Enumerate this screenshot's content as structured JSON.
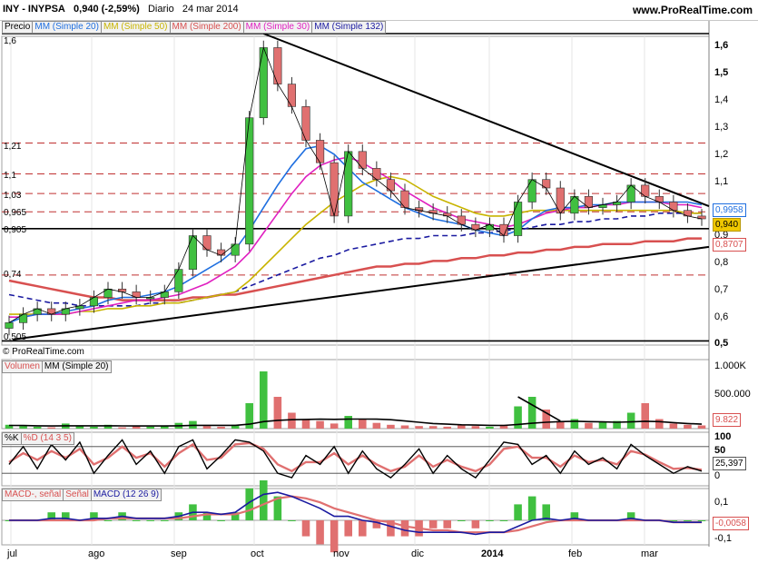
{
  "header": {
    "symbol": "INY - INYPSA",
    "quote": "0,940 (-2,59%)",
    "period": "Diario",
    "date": "24 mar 2014",
    "site": "www.ProRealTime.com"
  },
  "price_panel": {
    "legend": [
      "Precio",
      "MM (Simple 20)",
      "MM (Simple 50)",
      "MM (Simple 200)",
      "MM (Simple 30)",
      "MM (Simple 132)"
    ],
    "legend_colors": [
      "#000000",
      "#1f6fe0",
      "#c8b400",
      "#d85050",
      "#e020c0",
      "#1a1aa0"
    ],
    "copyright": "© ProRealTime.com",
    "y_ticks": [
      "1,6",
      "1,5",
      "1,4",
      "1,3",
      "1,2",
      "1,1",
      "1",
      "0,9",
      "0,8",
      "0,7",
      "0,6",
      "0,5"
    ],
    "levels": [
      "1,6",
      "1,21",
      "1,1",
      "1,03",
      "0,965",
      "0,905",
      "0,74",
      "0,505"
    ],
    "tags": [
      "0,9958",
      "0,940",
      "0,8707"
    ],
    "tag_colors": [
      "#1f6fe0",
      "#e0c000",
      "#d85050"
    ]
  },
  "volume_panel": {
    "legend": [
      "Volumen",
      "MM (Simple 20)"
    ],
    "y_ticks": [
      "1.000K",
      "500.000"
    ],
    "tag": "9.822"
  },
  "stoch_panel": {
    "legend": [
      "%K",
      "%D (14 3 5)"
    ],
    "y_ticks": [
      "100",
      "50",
      "0"
    ],
    "tag": "25,397"
  },
  "macd_panel": {
    "legend": [
      "MACD-, señal",
      "Señal",
      "MACD (12 26 9)"
    ],
    "y_ticks": [
      "0,1",
      "-0,1"
    ],
    "tag": "-0,0058"
  },
  "x_labels": [
    "jul",
    "ago",
    "sep",
    "oct",
    "nov",
    "dic",
    "2014",
    "feb",
    "mar"
  ],
  "chart_data": {
    "type": "line",
    "title": "INY - INYPSA",
    "ylim": [
      0.5,
      1.6
    ],
    "x_labels": [
      "jul",
      "ago",
      "sep",
      "oct",
      "nov",
      "dic",
      "2014",
      "feb",
      "mar"
    ],
    "series": [
      {
        "name": "Precio",
        "values": [
          0.57,
          0.6,
          0.62,
          0.6,
          0.62,
          0.63,
          0.66,
          0.69,
          0.68,
          0.66,
          0.66,
          0.68,
          0.76,
          0.88,
          0.83,
          0.81,
          0.85,
          1.3,
          1.55,
          1.42,
          1.34,
          1.22,
          1.14,
          0.95,
          1.18,
          1.12,
          1.08,
          1.04,
          0.98,
          0.97,
          0.96,
          0.95,
          0.92,
          0.9,
          0.92,
          0.88,
          1.0,
          1.08,
          1.05,
          0.96,
          1.02,
          0.98,
          0.99,
          1.0,
          1.06,
          1.02,
          1.0,
          0.97,
          0.95,
          0.94
        ]
      },
      {
        "name": "MM (Simple 20)",
        "values": [
          0.57,
          0.59,
          0.6,
          0.6,
          0.61,
          0.62,
          0.63,
          0.65,
          0.66,
          0.66,
          0.67,
          0.68,
          0.7,
          0.73,
          0.76,
          0.79,
          0.83,
          0.9,
          0.98,
          1.06,
          1.13,
          1.19,
          1.2,
          1.17,
          1.12,
          1.07,
          1.04,
          1.01,
          0.98,
          0.96,
          0.94,
          0.93,
          0.92,
          0.9,
          0.89,
          0.88,
          0.9,
          0.94,
          0.97,
          0.98,
          0.98,
          0.99,
          0.99,
          1.0,
          1.0,
          1.0,
          1.0,
          1.0,
          1.0,
          0.99
        ]
      },
      {
        "name": "MM (Simple 50)",
        "values": [
          0.6,
          0.6,
          0.6,
          0.6,
          0.6,
          0.61,
          0.61,
          0.62,
          0.62,
          0.63,
          0.63,
          0.64,
          0.64,
          0.65,
          0.66,
          0.67,
          0.68,
          0.72,
          0.77,
          0.82,
          0.87,
          0.92,
          0.96,
          1.0,
          1.03,
          1.06,
          1.08,
          1.09,
          1.08,
          1.05,
          1.02,
          1.0,
          0.98,
          0.96,
          0.95,
          0.95,
          0.96,
          0.97,
          0.97,
          0.97,
          0.97,
          0.97,
          0.97,
          0.97,
          0.97,
          0.97,
          0.97,
          0.97,
          0.96,
          0.96
        ]
      },
      {
        "name": "MM (Simple 200)",
        "values": [
          0.72,
          0.71,
          0.7,
          0.69,
          0.68,
          0.67,
          0.66,
          0.66,
          0.65,
          0.65,
          0.65,
          0.65,
          0.65,
          0.66,
          0.66,
          0.67,
          0.67,
          0.68,
          0.69,
          0.7,
          0.71,
          0.72,
          0.73,
          0.74,
          0.75,
          0.76,
          0.77,
          0.77,
          0.78,
          0.78,
          0.79,
          0.79,
          0.8,
          0.8,
          0.81,
          0.81,
          0.82,
          0.82,
          0.83,
          0.83,
          0.84,
          0.84,
          0.85,
          0.85,
          0.85,
          0.86,
          0.86,
          0.86,
          0.87,
          0.87
        ]
      },
      {
        "name": "MM (Simple 30)",
        "values": [
          0.59,
          0.59,
          0.6,
          0.6,
          0.6,
          0.61,
          0.62,
          0.63,
          0.64,
          0.65,
          0.65,
          0.66,
          0.67,
          0.69,
          0.71,
          0.74,
          0.77,
          0.82,
          0.89,
          0.96,
          1.03,
          1.09,
          1.13,
          1.15,
          1.16,
          1.14,
          1.11,
          1.08,
          1.04,
          1.01,
          0.98,
          0.96,
          0.94,
          0.93,
          0.92,
          0.91,
          0.92,
          0.94,
          0.96,
          0.97,
          0.98,
          0.98,
          0.99,
          0.99,
          1.0,
          1.0,
          1.0,
          0.99,
          0.99,
          0.98
        ]
      },
      {
        "name": "MM (Simple 132)",
        "values": [
          0.67,
          0.66,
          0.65,
          0.64,
          0.64,
          0.63,
          0.63,
          0.63,
          0.63,
          0.63,
          0.64,
          0.64,
          0.64,
          0.65,
          0.66,
          0.67,
          0.68,
          0.7,
          0.72,
          0.74,
          0.76,
          0.78,
          0.8,
          0.81,
          0.83,
          0.84,
          0.85,
          0.86,
          0.87,
          0.87,
          0.88,
          0.88,
          0.88,
          0.89,
          0.89,
          0.9,
          0.9,
          0.91,
          0.92,
          0.92,
          0.93,
          0.93,
          0.94,
          0.94,
          0.95,
          0.95,
          0.96,
          0.96,
          0.96,
          0.96
        ]
      }
    ],
    "volume": [
      60,
      40,
      30,
      20,
      80,
      50,
      30,
      60,
      20,
      40,
      30,
      50,
      90,
      120,
      40,
      30,
      60,
      400,
      900,
      500,
      250,
      150,
      120,
      80,
      200,
      150,
      90,
      60,
      50,
      40,
      40,
      30,
      60,
      40,
      30,
      60,
      350,
      500,
      300,
      120,
      150,
      90,
      100,
      120,
      250,
      400,
      150,
      80,
      60,
      50
    ],
    "volume_sma20": [
      50,
      48,
      45,
      42,
      45,
      45,
      44,
      45,
      43,
      42,
      41,
      42,
      45,
      52,
      52,
      51,
      52,
      70,
      110,
      130,
      140,
      145,
      148,
      146,
      150,
      150,
      148,
      140,
      120,
      100,
      80,
      70,
      60,
      55,
      52,
      50,
      65,
      85,
      100,
      110,
      115,
      110,
      105,
      100,
      105,
      115,
      110,
      95,
      80,
      70
    ],
    "stoch_k": [
      40,
      80,
      30,
      85,
      50,
      90,
      20,
      60,
      95,
      40,
      70,
      20,
      80,
      95,
      30,
      60,
      95,
      90,
      70,
      20,
      10,
      60,
      40,
      80,
      20,
      70,
      30,
      10,
      40,
      75,
      20,
      60,
      30,
      10,
      50,
      90,
      85,
      40,
      60,
      20,
      70,
      40,
      55,
      30,
      85,
      60,
      40,
      20,
      35,
      25
    ],
    "stoch_d": [
      45,
      65,
      50,
      70,
      55,
      75,
      40,
      55,
      80,
      55,
      65,
      35,
      65,
      85,
      50,
      55,
      85,
      88,
      75,
      40,
      25,
      45,
      45,
      65,
      40,
      60,
      40,
      25,
      35,
      60,
      35,
      50,
      35,
      25,
      40,
      75,
      80,
      55,
      55,
      35,
      60,
      45,
      50,
      40,
      70,
      62,
      45,
      30,
      32,
      28
    ],
    "macd": [
      0.0,
      0.0,
      0.0,
      0.01,
      0.01,
      0.0,
      0.01,
      0.01,
      0.02,
      0.01,
      0.01,
      0.01,
      0.02,
      0.04,
      0.04,
      0.03,
      0.04,
      0.09,
      0.13,
      0.14,
      0.12,
      0.09,
      0.06,
      0.02,
      0.02,
      0.0,
      -0.01,
      -0.03,
      -0.05,
      -0.06,
      -0.06,
      -0.06,
      -0.06,
      -0.07,
      -0.06,
      -0.06,
      -0.03,
      0.0,
      0.01,
      0.0,
      0.01,
      0.0,
      0.0,
      0.0,
      0.01,
      0.0,
      0.0,
      -0.01,
      -0.01,
      -0.01
    ],
    "macd_signal": [
      0.0,
      0.0,
      0.0,
      0.0,
      0.0,
      0.0,
      0.0,
      0.01,
      0.01,
      0.01,
      0.01,
      0.01,
      0.01,
      0.02,
      0.03,
      0.03,
      0.03,
      0.05,
      0.08,
      0.11,
      0.12,
      0.11,
      0.09,
      0.06,
      0.04,
      0.02,
      0.0,
      -0.01,
      -0.03,
      -0.04,
      -0.05,
      -0.05,
      -0.06,
      -0.06,
      -0.06,
      -0.06,
      -0.05,
      -0.03,
      -0.01,
      0.0,
      0.0,
      0.0,
      0.0,
      0.0,
      0.0,
      0.0,
      0.0,
      -0.01,
      -0.01,
      -0.01
    ]
  }
}
